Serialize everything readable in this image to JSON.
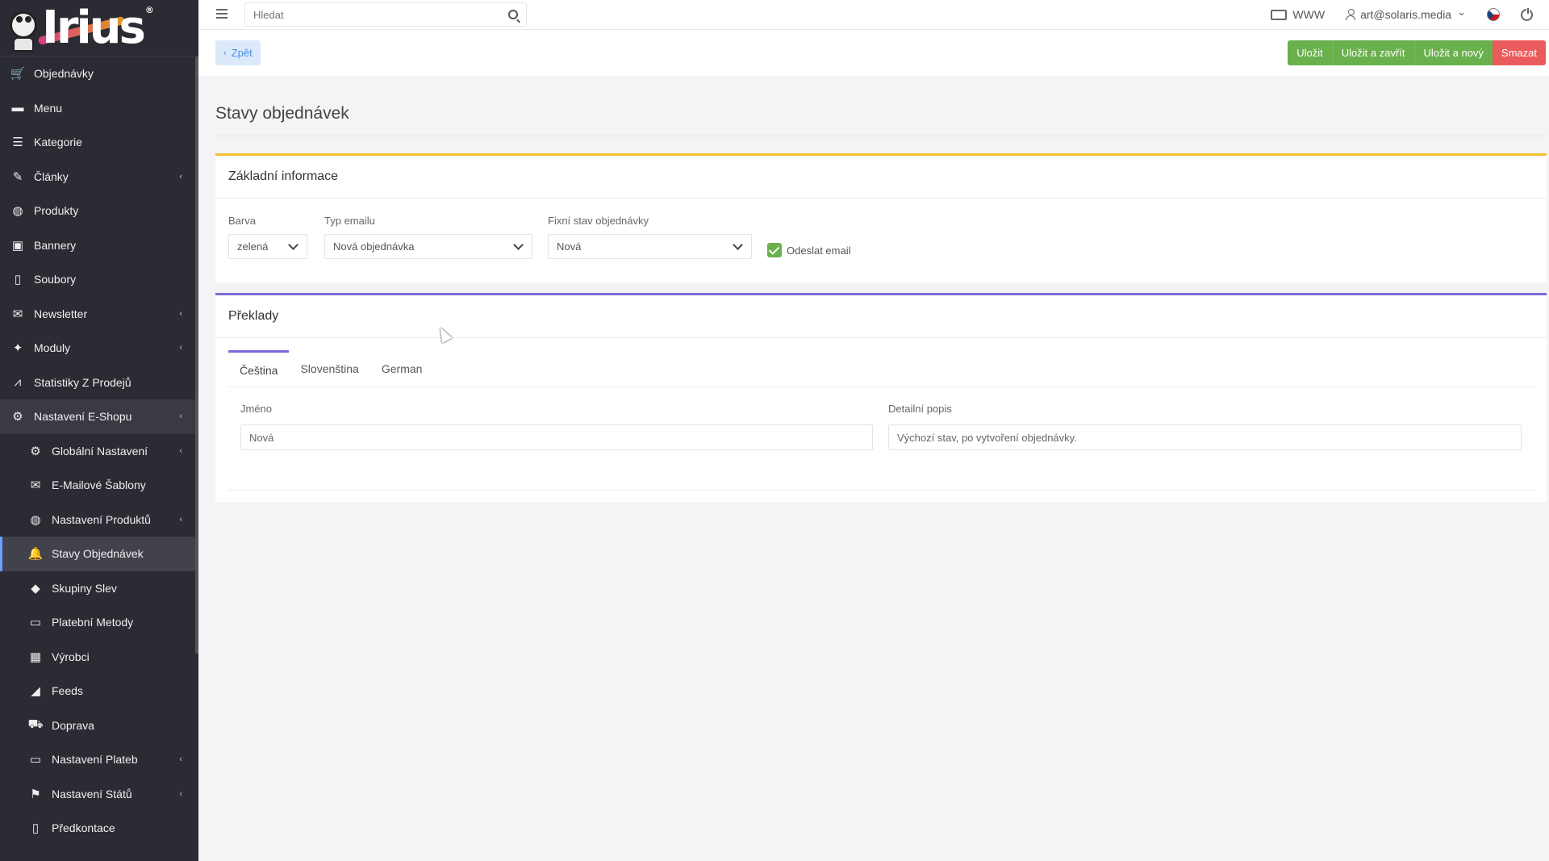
{
  "logo": {
    "text": "Irius",
    "reg": "®"
  },
  "sidebar": {
    "items": [
      {
        "label": "Objednávky",
        "icon": "cart-icon",
        "glyph": "🛒",
        "chevron": false
      },
      {
        "label": "Menu",
        "icon": "folder-icon",
        "glyph": "▬",
        "chevron": false
      },
      {
        "label": "Kategorie",
        "icon": "list-icon",
        "glyph": "☰",
        "chevron": false
      },
      {
        "label": "Články",
        "icon": "pencil-icon",
        "glyph": "✎",
        "chevron": true
      },
      {
        "label": "Produkty",
        "icon": "basketball-icon",
        "glyph": "◍",
        "chevron": false
      },
      {
        "label": "Bannery",
        "icon": "image-icon",
        "glyph": "▣",
        "chevron": false
      },
      {
        "label": "Soubory",
        "icon": "file-icon",
        "glyph": "▯",
        "chevron": false
      },
      {
        "label": "Newsletter",
        "icon": "mail-circle-icon",
        "glyph": "✉",
        "chevron": true
      },
      {
        "label": "Moduly",
        "icon": "puzzle-icon",
        "glyph": "✦",
        "chevron": true
      },
      {
        "label": "Statistiky Z Prodejů",
        "icon": "chart-line-icon",
        "glyph": "⩘",
        "chevron": false
      },
      {
        "label": "Nastavení E-Shopu",
        "icon": "cogs-icon",
        "glyph": "⚙",
        "chevron": true,
        "open": true
      }
    ],
    "subitems": [
      {
        "label": "Globální Nastavení",
        "icon": "gear-icon",
        "glyph": "⚙",
        "chevron": true
      },
      {
        "label": "E-Mailové Šablony",
        "icon": "envelope-icon",
        "glyph": "✉",
        "chevron": false
      },
      {
        "label": "Nastavení Produktů",
        "icon": "basketball-icon",
        "glyph": "◍",
        "chevron": true
      },
      {
        "label": "Stavy Objednávek",
        "icon": "bell-icon",
        "glyph": "🔔",
        "chevron": false,
        "active": true
      },
      {
        "label": "Skupiny Slev",
        "icon": "tag-icon",
        "glyph": "◆",
        "chevron": false
      },
      {
        "label": "Platební Metody",
        "icon": "credit-card-icon",
        "glyph": "▭",
        "chevron": false
      },
      {
        "label": "Výrobci",
        "icon": "building-icon",
        "glyph": "▦",
        "chevron": false
      },
      {
        "label": "Feeds",
        "icon": "rss-icon",
        "glyph": "◢",
        "chevron": false
      },
      {
        "label": "Doprava",
        "icon": "truck-icon",
        "glyph": "⛟",
        "chevron": false
      },
      {
        "label": "Nastavení Plateb",
        "icon": "credit-card-icon",
        "glyph": "▭",
        "chevron": true
      },
      {
        "label": "Nastavení Států",
        "icon": "flag-icon",
        "glyph": "⚑",
        "chevron": true
      },
      {
        "label": "Předkontace",
        "icon": "file-icon",
        "glyph": "▯",
        "chevron": false
      }
    ],
    "chevron_glyph": "‹"
  },
  "topbar": {
    "search_placeholder": "Hledat",
    "www_label": "WWW",
    "user_email": "art@solaris.media",
    "user_chevron": "⌄"
  },
  "actionbar": {
    "back_label": "Zpět",
    "back_chevron": "‹",
    "save_label": "Uložit",
    "save_close_label": "Uložit a zavřít",
    "save_new_label": "Uložit a nový",
    "delete_label": "Smazat"
  },
  "page": {
    "title": "Stavy objednávek"
  },
  "basic_info": {
    "heading": "Základní informace",
    "color_label": "Barva",
    "color_value": "zelená",
    "email_type_label": "Typ emailu",
    "email_type_value": "Nová objednávka",
    "fixed_state_label": "Fixní stav objednávky",
    "fixed_state_value": "Nová",
    "send_email_label": "Odeslat email",
    "send_email_checked": true
  },
  "translations": {
    "heading": "Překlady",
    "tabs": [
      {
        "label": "Čeština"
      },
      {
        "label": "Slovenština"
      },
      {
        "label": "German"
      }
    ],
    "active_tab": 0,
    "name_label": "Jméno",
    "name_value": "Nová",
    "description_label": "Detailní popis",
    "description_value": "Výchozí stav, po vytvoření objednávky."
  },
  "colors": {
    "sidebar_bg": "#2b2b33",
    "green": "#6ab04c",
    "red": "#ea5b5b",
    "accent_yellow": "#f2c230",
    "accent_purple": "#7b6cd9",
    "back_bg": "#dbe9fb"
  }
}
